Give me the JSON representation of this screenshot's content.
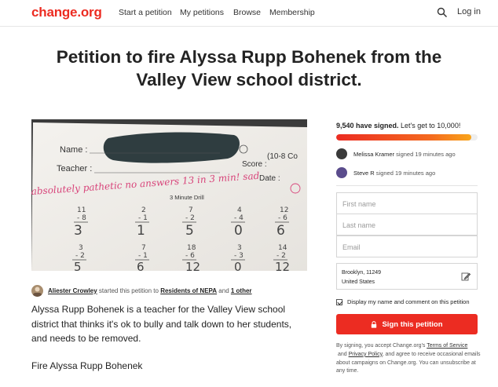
{
  "header": {
    "logo": "change.org",
    "nav": [
      "Start a petition",
      "My petitions",
      "Browse",
      "Membership"
    ],
    "login": "Log in"
  },
  "petition": {
    "title_line1": "Petition to fire Alyssa Rupp Bohenek from the",
    "title_line2": "Valley View school district.",
    "starter_name": "Aliester Crowley",
    "starter_mid": " started this petition to ",
    "starter_target": "Residents of NEPA",
    "starter_and": " and ",
    "starter_other": "1 other",
    "description": "Alyssa Rupp Bohenek is a teacher for the Valley View school district that thinks it's ok to bully and talk down to her students, and needs to be removed.",
    "description2": "Fire Alyssa Rupp Bohenek",
    "photo": {
      "name_label": "Name :",
      "teacher_label": "Teacher :",
      "score_label": "Score :",
      "date_label": "Date :",
      "score_fraction": "(10-8 Co",
      "drill_label": "3 Minute Drill",
      "handwritten_comment": "absolutely pathetic no answers 13 in 3 min! sad"
    }
  },
  "signatures": {
    "count": "9,540 have signed.",
    "goal_text": " Let's get to 10,000!",
    "progress": 0.954,
    "recent": [
      {
        "name": "Melissa Kramer",
        "action": " signed 19 minutes ago",
        "color": "#3a3a3a"
      },
      {
        "name": "Steve R",
        "action": " signed 19 minutes ago",
        "color": "#5a4c8c"
      }
    ]
  },
  "form": {
    "first_name_placeholder": "First name",
    "last_name_placeholder": "Last name",
    "email_placeholder": "Email",
    "location_line1": "Brooklyn, 11249",
    "location_line2": "United States",
    "display_checkbox_label": "Display my name and comment on this petition",
    "sign_button": "Sign this petition",
    "terms_pre": "By signing, you accept Change.org's ",
    "terms_link1": "Terms of Service",
    "terms_mid": " and ",
    "terms_link2": "Privacy Policy",
    "terms_post": ", and agree to receive occasional emails about campaigns on Change.org. You can unsubscribe at any time."
  },
  "colors": {
    "brand": "#ec2c22",
    "text": "#232323"
  }
}
